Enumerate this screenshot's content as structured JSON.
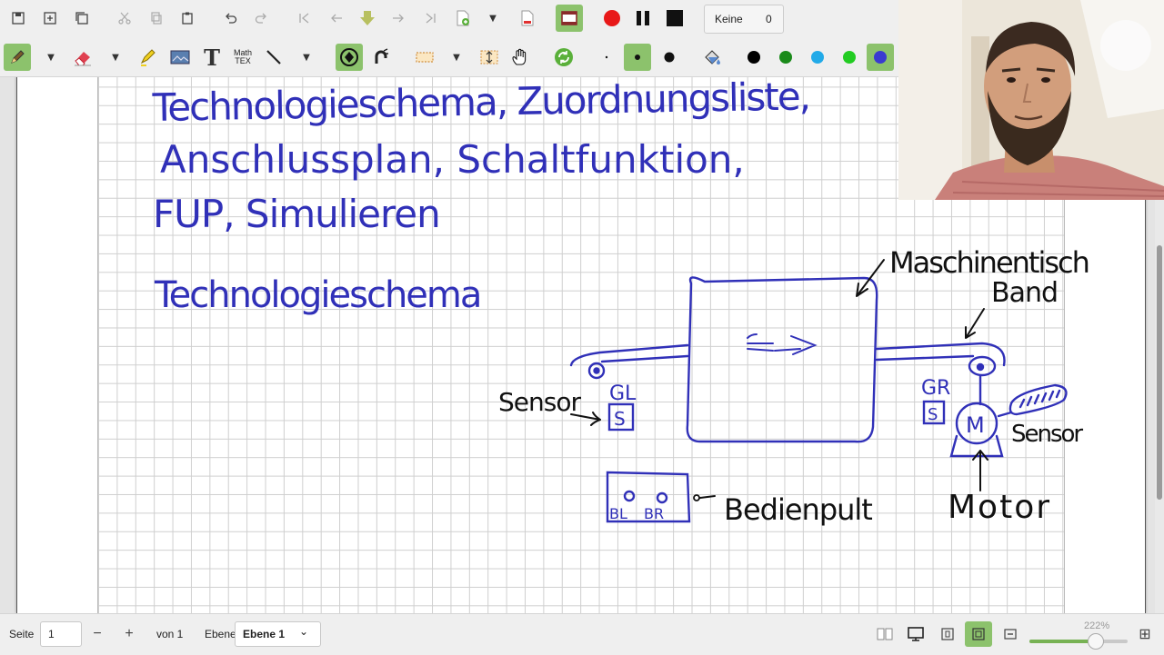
{
  "toolbar_top": {
    "icons": [
      "save-icon",
      "new-page-icon",
      "copy-page-icon",
      "cut-icon",
      "copy-icon",
      "paste-icon",
      "undo-icon",
      "redo-icon",
      "first-page-icon",
      "previous-page-icon",
      "goto-page-icon",
      "next-page-icon",
      "last-page-icon",
      "add-page-icon",
      "delete-page-icon",
      "presentation-icon",
      "record-icon",
      "pause-icon",
      "stop-icon"
    ],
    "counter_label": "Keine",
    "counter_value": "0"
  },
  "toolbar_tools": {
    "icons": [
      "pen-icon",
      "eraser-icon",
      "highlighter-icon",
      "image-icon",
      "text-icon",
      "math-tex-icon",
      "line-icon",
      "shape-recognizer-icon",
      "magnet-icon",
      "select-rect-icon",
      "vertical-space-icon",
      "hand-icon",
      "refresh-icon"
    ],
    "math_label_top": "Math",
    "math_label_bottom": "TEX",
    "text_label": "T"
  },
  "pen_sizes": [
    "fine",
    "medium",
    "thick"
  ],
  "colors": [
    "#000000",
    "#1a8a1a",
    "#22aae8",
    "#22cc22",
    "#3a3ad0"
  ],
  "fill_icon": "fill-bucket-icon",
  "colors_theme": {
    "accent": "#8cc26c",
    "ink_blue": "#3030b8",
    "ink_black": "#111111"
  },
  "statusbar": {
    "page_label": "Seite",
    "page_value": "1",
    "minus": "−",
    "plus": "+",
    "of_label": "von 1",
    "layer_label": "Ebene",
    "layer_value": "Ebene 1",
    "layer_chevron": "⌄",
    "zoom_label": "222%",
    "zoom_fraction": 0.67,
    "view_icons": [
      "two-page-icon",
      "single-page-icon",
      "fit-page-icon",
      "fit-width-icon",
      "continuous-icon"
    ],
    "zoom_plus": "⊞"
  },
  "notes": {
    "line1": "Technologieschema, Zuordnungsliste,",
    "line2": "Anschlussplan, Schaltfunktion,",
    "line3": "FUP, Simulieren",
    "heading": "Technologieschema",
    "machine_label_1": "Maschinentisch",
    "machine_label_2": "Band",
    "arrow_symbol": "⟸⟹",
    "sensor_left": "Sensor",
    "gl_label": "GL",
    "gr_label": "GR",
    "s_label": "S",
    "m_label": "M",
    "sensor_right": "Sensor",
    "motor_label": "Motor",
    "panel_label": "Bedienpult",
    "bl_label": "BL",
    "br_label": "BR"
  }
}
